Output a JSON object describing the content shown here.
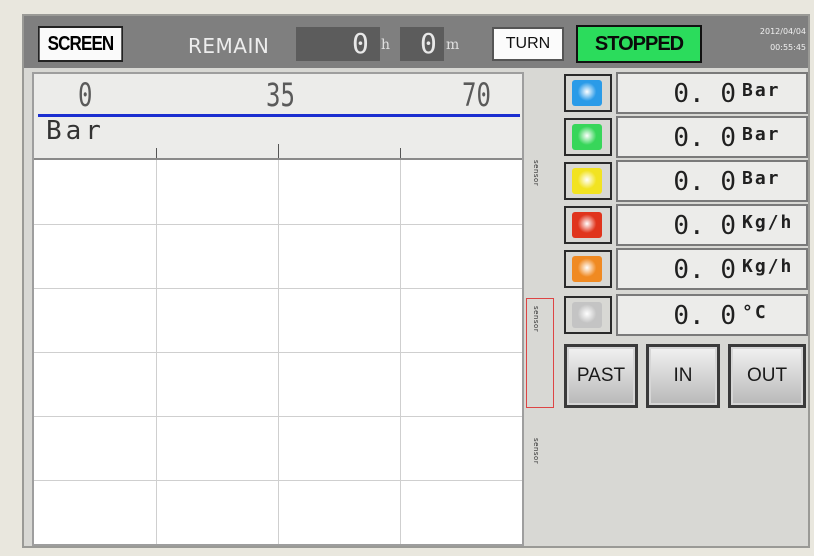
{
  "header": {
    "screen_label": "SCREEN",
    "remain_label": "REMAIN",
    "remain_hours": "0",
    "hours_unit": "h",
    "remain_minutes": "0",
    "minutes_unit": "m",
    "turn_label": "TURN",
    "status_label": "STOPPED",
    "date": "2012/04/04",
    "time": "00:55:45"
  },
  "chart": {
    "scale_labels": [
      "0",
      "35",
      "70"
    ],
    "unit": "Bar",
    "scale_line_color": "#1a2ed0"
  },
  "readouts": [
    {
      "color": "#2a9be8",
      "value": "0. 0",
      "unit": "Bar",
      "icon": "blue-lamp"
    },
    {
      "color": "#38d65a",
      "value": "0. 0",
      "unit": "Bar",
      "icon": "green-lamp"
    },
    {
      "color": "#f2e321",
      "value": "0. 0",
      "unit": "Bar",
      "icon": "yellow-lamp"
    },
    {
      "color": "#e0341c",
      "value": "0. 0",
      "unit": "Kg/h",
      "icon": "red-lamp"
    },
    {
      "color": "#f08a22",
      "value": "0. 0",
      "unit": "Kg/h",
      "icon": "orange-lamp"
    },
    {
      "color": "#c4c4c4",
      "value": "0. 0",
      "unit": "°C",
      "icon": "gray-lamp"
    }
  ],
  "controls": {
    "past_label": "PAST",
    "in_label": "IN",
    "out_label": "OUT"
  },
  "side_labels": [
    "sensor",
    "sensor",
    "sensor"
  ]
}
